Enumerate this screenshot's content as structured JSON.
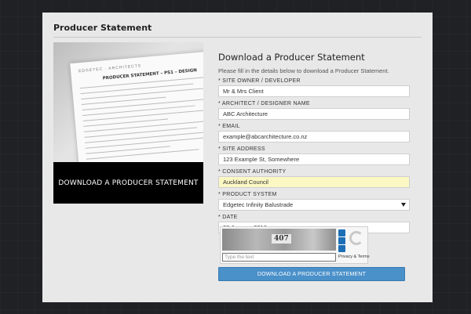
{
  "panel": {
    "title": "Producer Statement"
  },
  "preview": {
    "banner_label": "DOWNLOAD A PRODUCER STATEMENT",
    "doc_title": "PRODUCER STATEMENT – PS1 – DESIGN"
  },
  "form": {
    "heading": "Download a Producer Statement",
    "intro": "Please fill in the details below to download a Producer Statement.",
    "fields": [
      {
        "label": "* SITE OWNER / DEVELOPER",
        "value": "Mr & Mrs Client"
      },
      {
        "label": "* ARCHITECT / DESIGNER NAME",
        "value": "ABC Architecture"
      },
      {
        "label": "* EMAIL",
        "value": "example@abcarchitecture.co.nz"
      },
      {
        "label": "* SITE ADDRESS",
        "value": "123 Example St, Somewhere"
      },
      {
        "label": "* CONSENT AUTHORITY",
        "value": "Auckland Council"
      },
      {
        "label": "* PRODUCT SYSTEM",
        "value": "Edgetec Infinity Balustrade"
      },
      {
        "label": "* DATE",
        "value": "28 January 2016"
      }
    ],
    "captcha": {
      "code": "407",
      "placeholder": "Type the text",
      "links": "Privacy & Terms"
    },
    "submit_label": "DOWNLOAD A PRODUCER STATEMENT"
  },
  "colors": {
    "accent": "#4a90c9",
    "highlight": "#fbf8c4"
  },
  "icons": [
    "refresh-icon",
    "audio-icon",
    "help-icon",
    "recaptcha-logo-icon",
    "chevron-down-icon"
  ]
}
